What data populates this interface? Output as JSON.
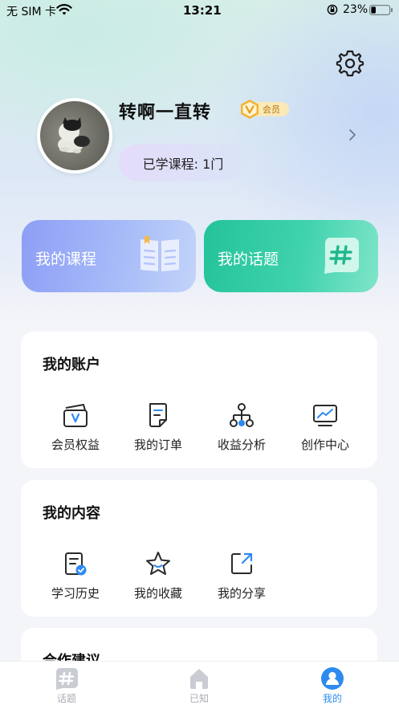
{
  "status_bar": {
    "carrier": "无 SIM 卡",
    "time": "13:21",
    "battery": "23%"
  },
  "profile": {
    "username": "转啊一直转",
    "vip_label": "会员",
    "courses_learned": "已学课程: 1门"
  },
  "shortcuts": [
    {
      "label": "我的课程",
      "icon": "open-book-icon"
    },
    {
      "label": "我的话题",
      "icon": "hashtag-icon"
    }
  ],
  "sections": {
    "account": {
      "title": "我的账户",
      "items": [
        {
          "label": "会员权益",
          "icon": "vip-card-icon"
        },
        {
          "label": "我的订单",
          "icon": "order-doc-icon"
        },
        {
          "label": "收益分析",
          "icon": "network-icon"
        },
        {
          "label": "创作中心",
          "icon": "monitor-chart-icon"
        }
      ]
    },
    "content": {
      "title": "我的内容",
      "items": [
        {
          "label": "学习历史",
          "icon": "history-doc-icon"
        },
        {
          "label": "我的收藏",
          "icon": "star-icon"
        },
        {
          "label": "我的分享",
          "icon": "share-icon"
        }
      ]
    },
    "cooperation": {
      "title": "合作建议"
    }
  },
  "tabbar": [
    {
      "label": "话题",
      "icon": "hashtag-icon",
      "active": false
    },
    {
      "label": "已知",
      "icon": "home-icon",
      "active": false
    },
    {
      "label": "我的",
      "icon": "profile-icon",
      "active": true
    }
  ],
  "colors": {
    "accent": "#2d8bf0",
    "courses_card": "#8d9ef6",
    "topics_card": "#24c39a",
    "vip_gold": "#f2b431"
  }
}
